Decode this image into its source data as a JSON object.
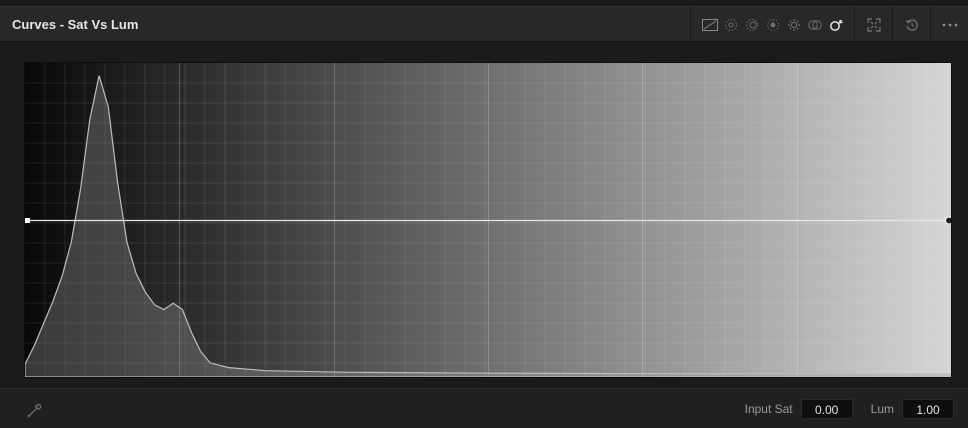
{
  "panel": {
    "title": "Curves - Sat Vs Lum"
  },
  "toolbar": {
    "icons": [
      "custom-curve-icon",
      "hue-vs-hue-icon",
      "hue-vs-sat-icon",
      "hue-vs-lum-icon",
      "lum-vs-sat-icon",
      "sat-vs-sat-icon",
      "sat-vs-lum-icon",
      "expand-icon",
      "reset-icon",
      "more-options-icon"
    ],
    "active_icon": "sat-vs-lum-icon"
  },
  "graph": {
    "background_gradient": [
      "#080808",
      "#d6d6d6"
    ],
    "curve_level": 0.5,
    "histogram": [
      [
        0.0,
        0.04
      ],
      [
        0.01,
        0.1
      ],
      [
        0.02,
        0.17
      ],
      [
        0.03,
        0.24
      ],
      [
        0.04,
        0.32
      ],
      [
        0.05,
        0.43
      ],
      [
        0.06,
        0.6
      ],
      [
        0.07,
        0.82
      ],
      [
        0.08,
        0.96
      ],
      [
        0.09,
        0.86
      ],
      [
        0.1,
        0.62
      ],
      [
        0.11,
        0.43
      ],
      [
        0.12,
        0.33
      ],
      [
        0.13,
        0.27
      ],
      [
        0.14,
        0.23
      ],
      [
        0.15,
        0.215
      ],
      [
        0.16,
        0.235
      ],
      [
        0.17,
        0.215
      ],
      [
        0.18,
        0.14
      ],
      [
        0.19,
        0.08
      ],
      [
        0.2,
        0.045
      ],
      [
        0.22,
        0.03
      ],
      [
        0.26,
        0.02
      ],
      [
        0.35,
        0.015
      ],
      [
        0.5,
        0.012
      ],
      [
        0.75,
        0.01
      ],
      [
        1.0,
        0.01
      ]
    ]
  },
  "footer": {
    "picker_icon": "eyedropper-icon",
    "input_sat_label": "Input Sat",
    "input_sat_value": "0.00",
    "lum_label": "Lum",
    "lum_value": "1.00"
  }
}
